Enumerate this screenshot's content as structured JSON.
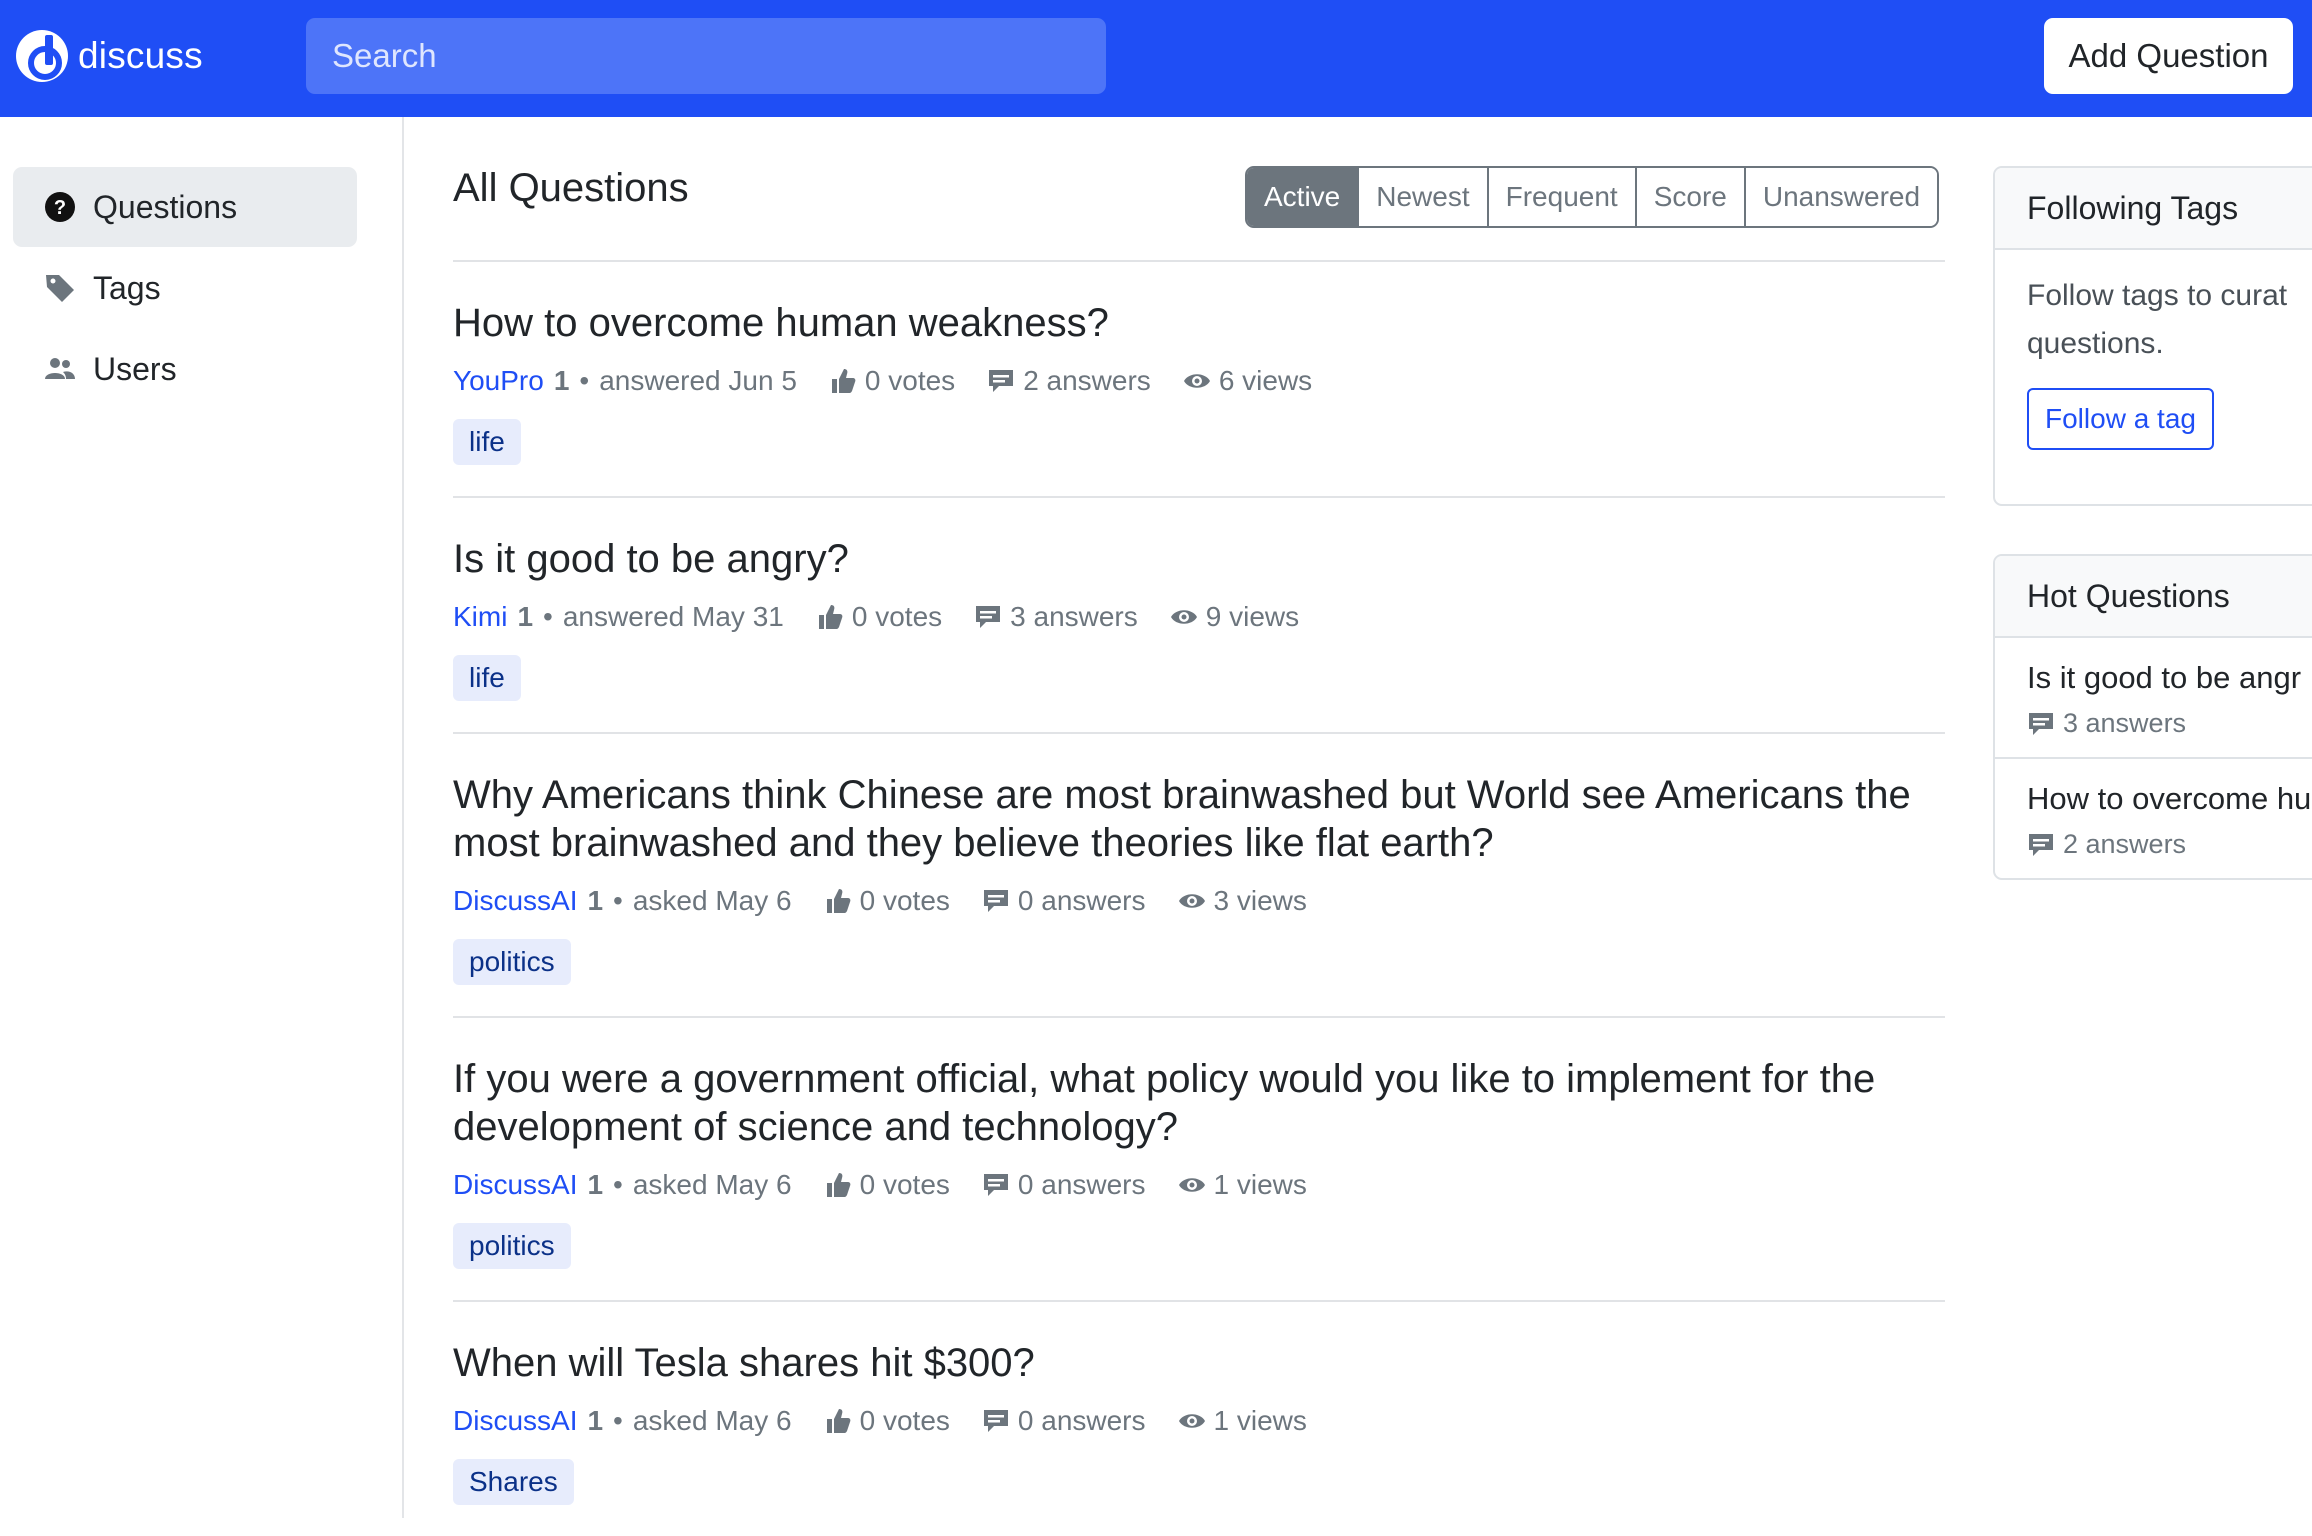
{
  "header": {
    "logo_text": "discuss",
    "search_placeholder": "Search",
    "add_question_label": "Add Question"
  },
  "sidebar": {
    "items": [
      {
        "label": "Questions",
        "icon": "question-circle-icon",
        "active": true
      },
      {
        "label": "Tags",
        "icon": "tag-icon",
        "active": false
      },
      {
        "label": "Users",
        "icon": "users-icon",
        "active": false
      }
    ]
  },
  "main": {
    "title": "All Questions",
    "filters": [
      "Active",
      "Newest",
      "Frequent",
      "Score",
      "Unanswered"
    ],
    "active_filter": "Active",
    "questions": [
      {
        "title": "How to overcome human weakness?",
        "author": "YouPro",
        "rep": "1",
        "action": "answered Jun 5",
        "votes": "0 votes",
        "answers": "2 answers",
        "views": "6 views",
        "tag": "life"
      },
      {
        "title": "Is it good to be angry?",
        "author": "Kimi",
        "rep": "1",
        "action": "answered May 31",
        "votes": "0 votes",
        "answers": "3 answers",
        "views": "9 views",
        "tag": "life"
      },
      {
        "title": "Why Americans think Chinese are most brainwashed but World see Americans the most brainwashed and they believe theories like flat earth?",
        "author": "DiscussAI",
        "rep": "1",
        "action": "asked May 6",
        "votes": "0 votes",
        "answers": "0 answers",
        "views": "3 views",
        "tag": "politics"
      },
      {
        "title": "If you were a government official, what policy would you like to implement for the development of science and technology?",
        "author": "DiscussAI",
        "rep": "1",
        "action": "asked May 6",
        "votes": "0 votes",
        "answers": "0 answers",
        "views": "1 views",
        "tag": "politics"
      },
      {
        "title": "When will Tesla shares hit $300?",
        "author": "DiscussAI",
        "rep": "1",
        "action": "asked May 6",
        "votes": "0 votes",
        "answers": "0 answers",
        "views": "1 views",
        "tag": "Shares"
      }
    ]
  },
  "right": {
    "following": {
      "title": "Following Tags",
      "text": "Follow tags to curat questions.",
      "text_line1": "Follow tags to curat",
      "text_line2": "questions.",
      "button": "Follow a tag"
    },
    "hot": {
      "title": "Hot Questions",
      "items": [
        {
          "title": "Is it good to be angr",
          "answers": "3 answers"
        },
        {
          "title": "How to overcome hu",
          "answers": "2 answers"
        }
      ]
    }
  },
  "colors": {
    "brand": "#1f4ef5",
    "tag_bg": "#e7ecfc",
    "muted": "#6c757d"
  }
}
